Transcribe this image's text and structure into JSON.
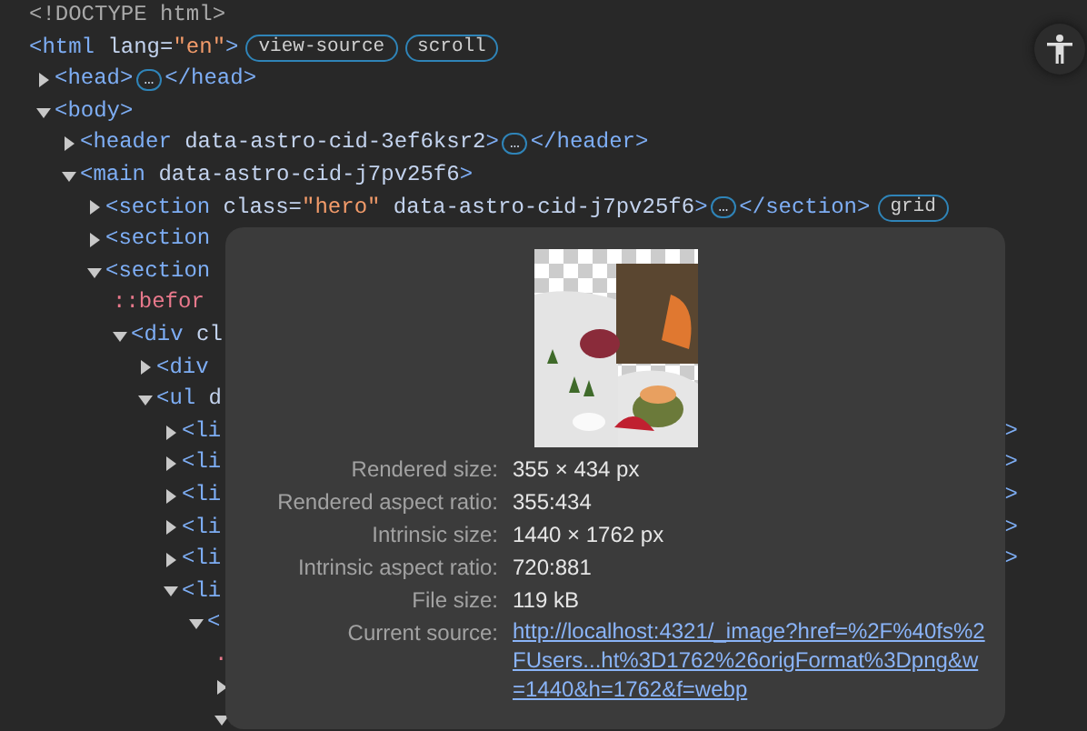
{
  "tree": [
    {
      "parts": [
        {
          "kind": "doctype",
          "text": "<!DOCTYPE html>"
        }
      ]
    },
    {
      "parts": [
        {
          "kind": "tag",
          "text": "<html"
        },
        {
          "kind": "attr",
          "text": "lang="
        },
        {
          "kind": "value",
          "text": "\"en\""
        },
        {
          "kind": "tag",
          "text": ">"
        },
        {
          "kind": "badge",
          "text": "view-source"
        },
        {
          "kind": "badge",
          "text": "scroll"
        }
      ],
      "children": [
        {
          "parts": [
            {
              "kind": "tag",
              "text": "<head>"
            },
            {
              "kind": "ellipsis",
              "text": "…"
            },
            {
              "kind": "tag",
              "text": "</head>"
            }
          ],
          "expanded": false
        },
        {
          "parts": [
            {
              "kind": "tag",
              "text": "<body>"
            }
          ],
          "expanded": true,
          "children": [
            {
              "parts": [
                {
                  "kind": "tag",
                  "text": "<header"
                },
                {
                  "kind": "attr",
                  "text": "data-astro-cid-3ef6ksr2"
                },
                {
                  "kind": "tag",
                  "text": ">"
                },
                {
                  "kind": "ellipsis",
                  "text": "…"
                },
                {
                  "kind": "tag",
                  "text": "</header>"
                }
              ],
              "expanded": false
            },
            {
              "parts": [
                {
                  "kind": "tag",
                  "text": "<main"
                },
                {
                  "kind": "attr",
                  "text": "data-astro-cid-j7pv25f6"
                },
                {
                  "kind": "tag",
                  "text": ">"
                }
              ],
              "expanded": true,
              "children": [
                {
                  "parts": [
                    {
                      "kind": "tag",
                      "text": "<section"
                    },
                    {
                      "kind": "attr",
                      "text": "class="
                    },
                    {
                      "kind": "value",
                      "text": "\"hero\""
                    },
                    {
                      "kind": "attr",
                      "text": "data-astro-cid-j7pv25f6"
                    },
                    {
                      "kind": "tag",
                      "text": ">"
                    },
                    {
                      "kind": "ellipsis",
                      "text": "…"
                    },
                    {
                      "kind": "tag",
                      "text": "</section>"
                    },
                    {
                      "kind": "badge",
                      "text": "grid"
                    }
                  ],
                  "expanded": false
                },
                {
                  "parts": [
                    {
                      "kind": "tag",
                      "text": "<section"
                    }
                  ],
                  "expanded": false
                },
                {
                  "parts": [
                    {
                      "kind": "tag",
                      "text": "<section"
                    }
                  ],
                  "expanded": true,
                  "children": [
                    {
                      "parts": [
                        {
                          "kind": "pseudo",
                          "text": "::befor"
                        }
                      ]
                    },
                    {
                      "parts": [
                        {
                          "kind": "tag",
                          "text": "<div"
                        },
                        {
                          "kind": "attr",
                          "text": "cl"
                        }
                      ],
                      "expanded": true,
                      "children": [
                        {
                          "parts": [
                            {
                              "kind": "tag",
                              "text": "<div"
                            }
                          ],
                          "expanded": false
                        },
                        {
                          "parts": [
                            {
                              "kind": "tag",
                              "text": "<ul"
                            },
                            {
                              "kind": "attr",
                              "text": "d"
                            }
                          ],
                          "expanded": true,
                          "children": [
                            {
                              "parts": [
                                {
                                  "kind": "tag",
                                  "text": "<li"
                                }
                              ],
                              "tail": ">",
                              "expanded": false
                            },
                            {
                              "parts": [
                                {
                                  "kind": "tag",
                                  "text": "<li"
                                }
                              ],
                              "tail": ">",
                              "expanded": false
                            },
                            {
                              "parts": [
                                {
                                  "kind": "tag",
                                  "text": "<li"
                                }
                              ],
                              "tail": ">",
                              "expanded": false
                            },
                            {
                              "parts": [
                                {
                                  "kind": "tag",
                                  "text": "<li"
                                }
                              ],
                              "tail": ">",
                              "expanded": false
                            },
                            {
                              "parts": [
                                {
                                  "kind": "tag",
                                  "text": "<li"
                                }
                              ],
                              "tail": ">",
                              "expanded": false
                            },
                            {
                              "parts": [
                                {
                                  "kind": "tag",
                                  "text": "<li"
                                }
                              ],
                              "expanded": true,
                              "children": [
                                {
                                  "parts": [
                                    {
                                      "kind": "tag",
                                      "text": "<"
                                    }
                                  ],
                                  "expanded": true,
                                  "children": [
                                    {
                                      "parts": [
                                        {
                                          "kind": "pseudo",
                                          "text": "."
                                        }
                                      ]
                                    },
                                    {
                                      "expanded": false
                                    },
                                    {
                                      "expanded": true
                                    }
                                  ]
                                }
                              ]
                            }
                          ]
                        }
                      ]
                    }
                  ]
                }
              ]
            }
          ]
        }
      ]
    }
  ],
  "tooltip": {
    "rows": [
      {
        "label": "Rendered size:",
        "value": "355 × 434 px",
        "kind": "text"
      },
      {
        "label": "Rendered aspect ratio:",
        "value": "355:434",
        "kind": "text"
      },
      {
        "label": "Intrinsic size:",
        "value": "1440 × 1762 px",
        "kind": "text"
      },
      {
        "label": "Intrinsic aspect ratio:",
        "value": "720:881",
        "kind": "text"
      },
      {
        "label": "File size:",
        "value": "119 kB",
        "kind": "text"
      },
      {
        "label": "Current source:",
        "value": "http://localhost:4321/_image?href=%2F%40fs%2FUsers...ht%3D1762%26origFormat%3Dpng&w=1440&h=1762&f=webp",
        "kind": "link"
      }
    ]
  }
}
